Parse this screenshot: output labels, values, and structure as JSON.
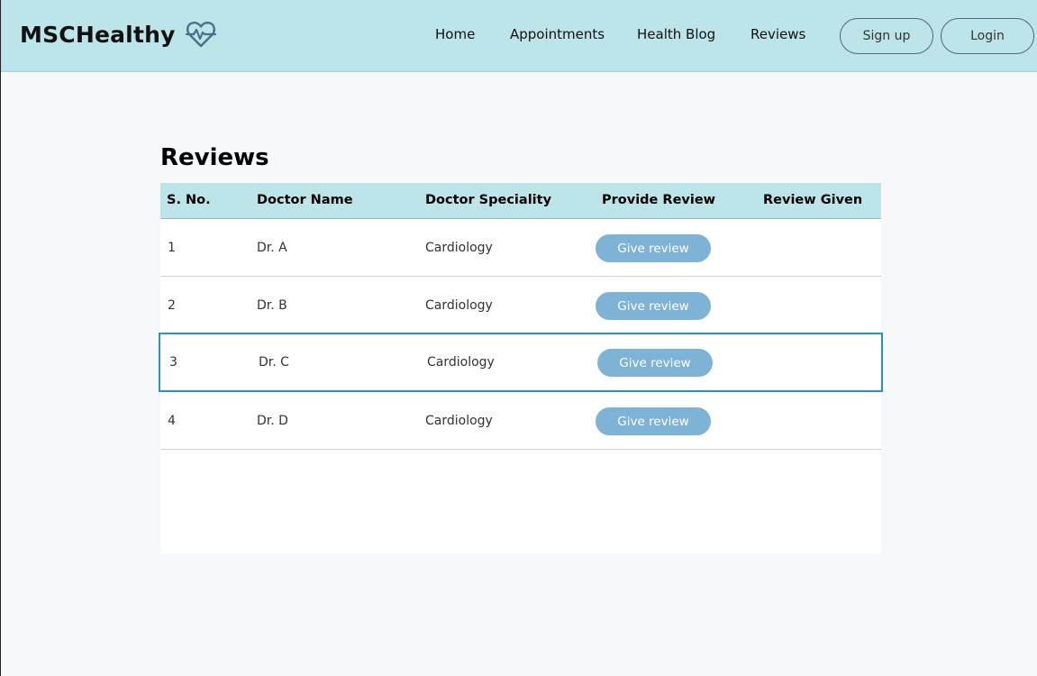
{
  "brand": {
    "name": "MSCHealthy",
    "icon": "heart-pulse-icon"
  },
  "nav": {
    "links": [
      "Home",
      "Appointments",
      "Health Blog",
      "Reviews"
    ],
    "signup_label": "Sign up",
    "login_label": "Login"
  },
  "page": {
    "title": "Reviews"
  },
  "table": {
    "headers": [
      "S. No.",
      "Doctor Name",
      "Doctor Speciality",
      "Provide Review",
      "Review Given"
    ],
    "rows": [
      {
        "sno": "1",
        "doctor": "Dr. A",
        "speciality": "Cardiology",
        "action": "Give review",
        "review": ""
      },
      {
        "sno": "2",
        "doctor": "Dr. B",
        "speciality": "Cardiology",
        "action": "Give review",
        "review": ""
      },
      {
        "sno": "3",
        "doctor": "Dr. C",
        "speciality": "Cardiology",
        "action": "Give review",
        "review": ""
      },
      {
        "sno": "4",
        "doctor": "Dr. D",
        "speciality": "Cardiology",
        "action": "Give review",
        "review": ""
      }
    ],
    "selected_row": 3
  },
  "colors": {
    "navbar_bg": "#bde4e8",
    "button_bg": "#7eb3d6",
    "selection_border": "#2a8fcf",
    "page_bg": "#f7f8fa"
  }
}
